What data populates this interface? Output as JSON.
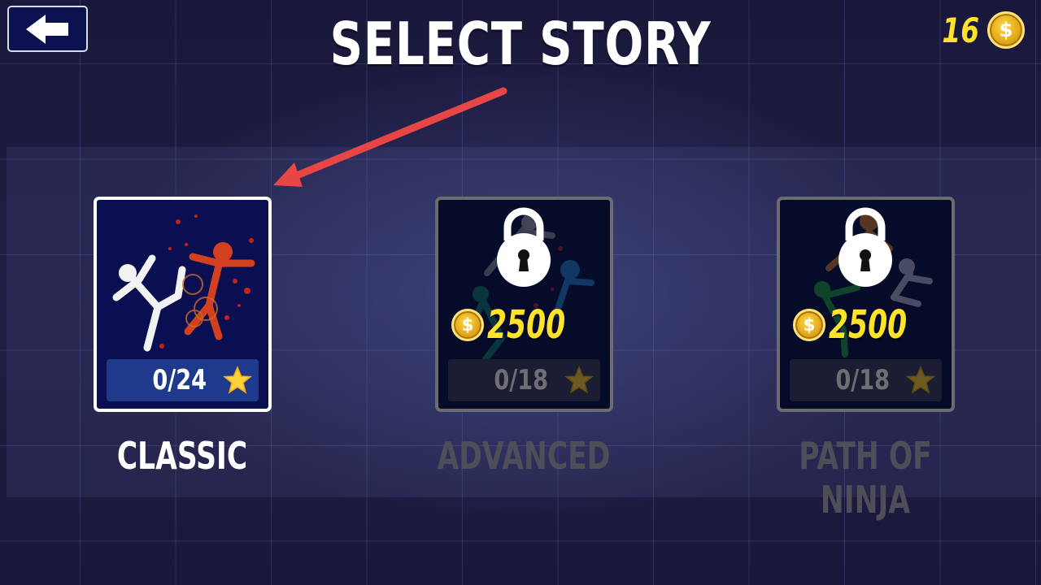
{
  "header": {
    "title": "SELECT STORY",
    "coins": "16",
    "coin_symbol": "$"
  },
  "stories": [
    {
      "name": "CLASSIC",
      "stars": "0/24",
      "locked": false
    },
    {
      "name": "ADVANCED",
      "stars": "0/18",
      "locked": true,
      "price": "2500"
    },
    {
      "name": "PATH OF NINJA",
      "stars": "0/18",
      "locked": true,
      "price": "2500"
    }
  ],
  "icons": {
    "back": "back-arrow-icon",
    "coin": "coin-icon",
    "star": "star-icon",
    "lock": "padlock-icon"
  },
  "colors": {
    "coin_text": "#ffe22a",
    "selected_border": "#ffffff",
    "locked_border": "#6b6b70",
    "annotation_arrow": "#e84545"
  }
}
